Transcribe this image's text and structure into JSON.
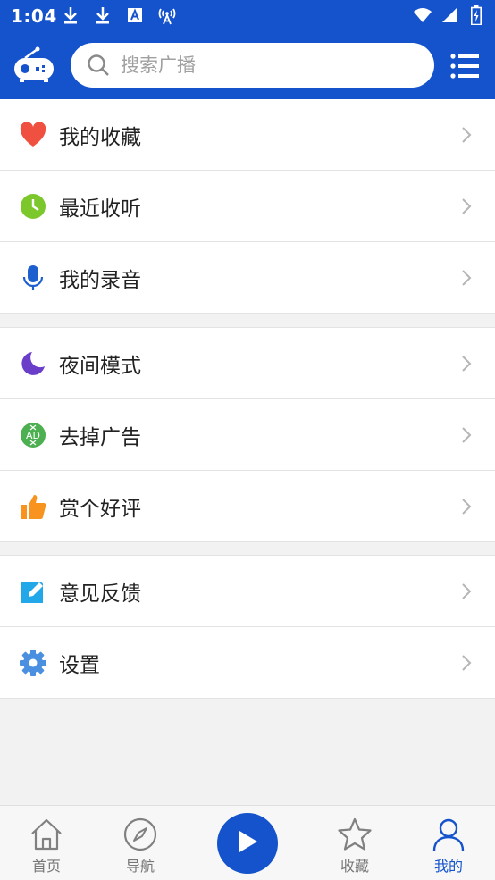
{
  "status_bar": {
    "time": "1:04"
  },
  "header": {
    "search": {
      "placeholder": "搜索广播",
      "value": ""
    }
  },
  "menu_groups": [
    {
      "items": [
        {
          "label": "我的收藏",
          "icon": "heart-icon",
          "color": "#f0503f"
        },
        {
          "label": "最近收听",
          "icon": "clock-icon",
          "color": "#7cc82c"
        },
        {
          "label": "我的录音",
          "icon": "microphone-icon",
          "color": "#1e5fcf"
        }
      ]
    },
    {
      "items": [
        {
          "label": "夜间模式",
          "icon": "moon-icon",
          "color": "#6b3ec9"
        },
        {
          "label": "去掉广告",
          "icon": "remove-ads-icon",
          "color": "#4caf50"
        },
        {
          "label": "赏个好评",
          "icon": "thumbs-up-icon",
          "color": "#f7931e"
        }
      ]
    },
    {
      "items": [
        {
          "label": "意见反馈",
          "icon": "feedback-edit-icon",
          "color": "#22a7e8"
        },
        {
          "label": "设置",
          "icon": "gear-icon",
          "color": "#4a8fe0"
        }
      ]
    }
  ],
  "tab_bar": {
    "tabs": [
      {
        "label": "首页",
        "icon": "home-icon",
        "active": false
      },
      {
        "label": "导航",
        "icon": "compass-icon",
        "active": false
      },
      {
        "label": "收藏",
        "icon": "star-icon",
        "active": false
      },
      {
        "label": "我的",
        "icon": "person-icon",
        "active": true
      }
    ],
    "play_icon": "play-icon"
  },
  "colors": {
    "brand": "#1453cc",
    "background": "#f2f2f2",
    "inactive_tab": "#777777"
  }
}
